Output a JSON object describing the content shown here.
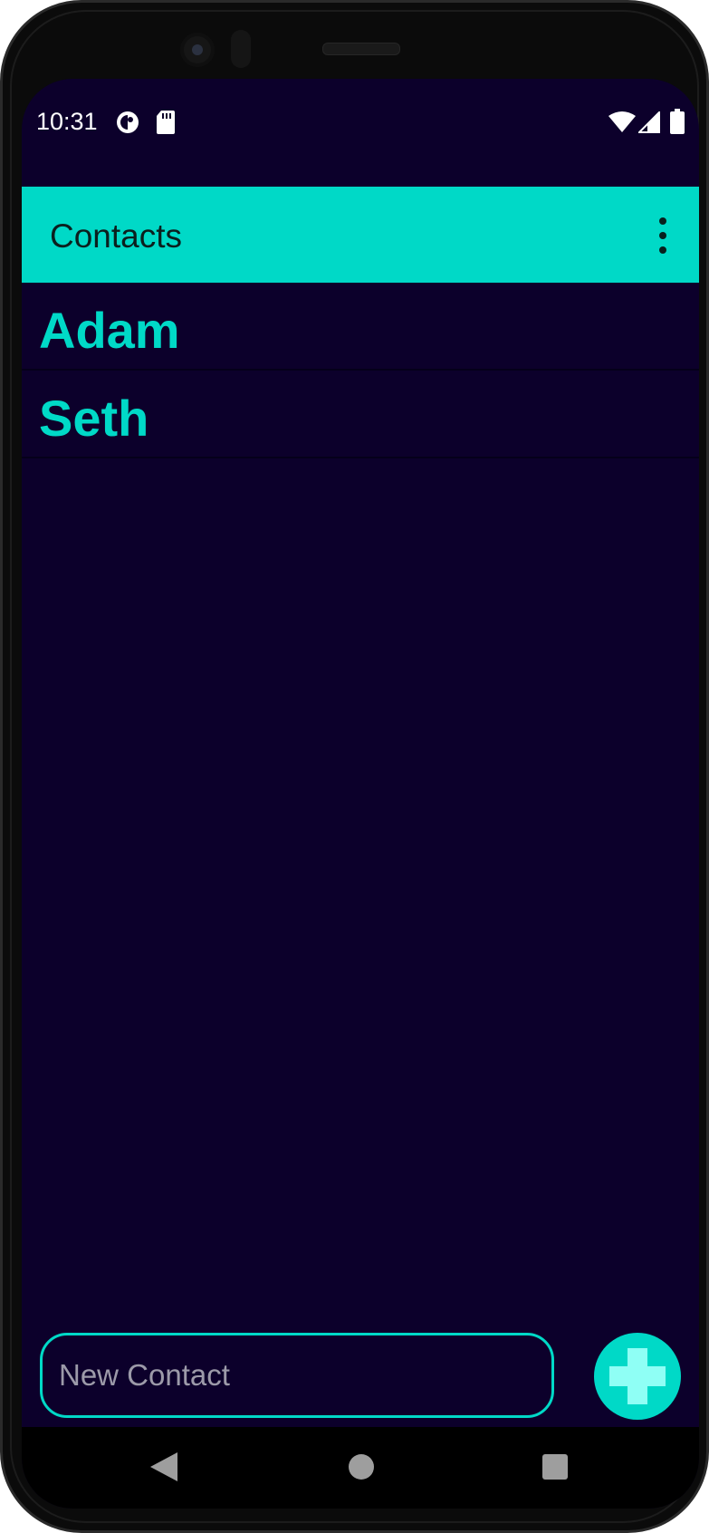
{
  "status_bar": {
    "time": "10:31",
    "icons": [
      "data-saver-icon",
      "sd-card-icon",
      "wifi-icon",
      "cell-signal-icon",
      "battery-icon"
    ]
  },
  "app_bar": {
    "title": "Contacts",
    "menu_icon": "more-vert-icon"
  },
  "contacts": [
    {
      "name": "Adam"
    },
    {
      "name": "Seth"
    }
  ],
  "new_contact": {
    "placeholder": "New Contact",
    "value": ""
  },
  "add_button": {
    "icon": "plus-icon"
  },
  "nav_bar": {
    "icons": [
      "back-icon",
      "home-icon",
      "recents-icon"
    ]
  },
  "colors": {
    "background": "#0c002b",
    "accent": "#00d9c7",
    "plus": "#8ffff5",
    "placeholder": "#9c9aa9"
  }
}
